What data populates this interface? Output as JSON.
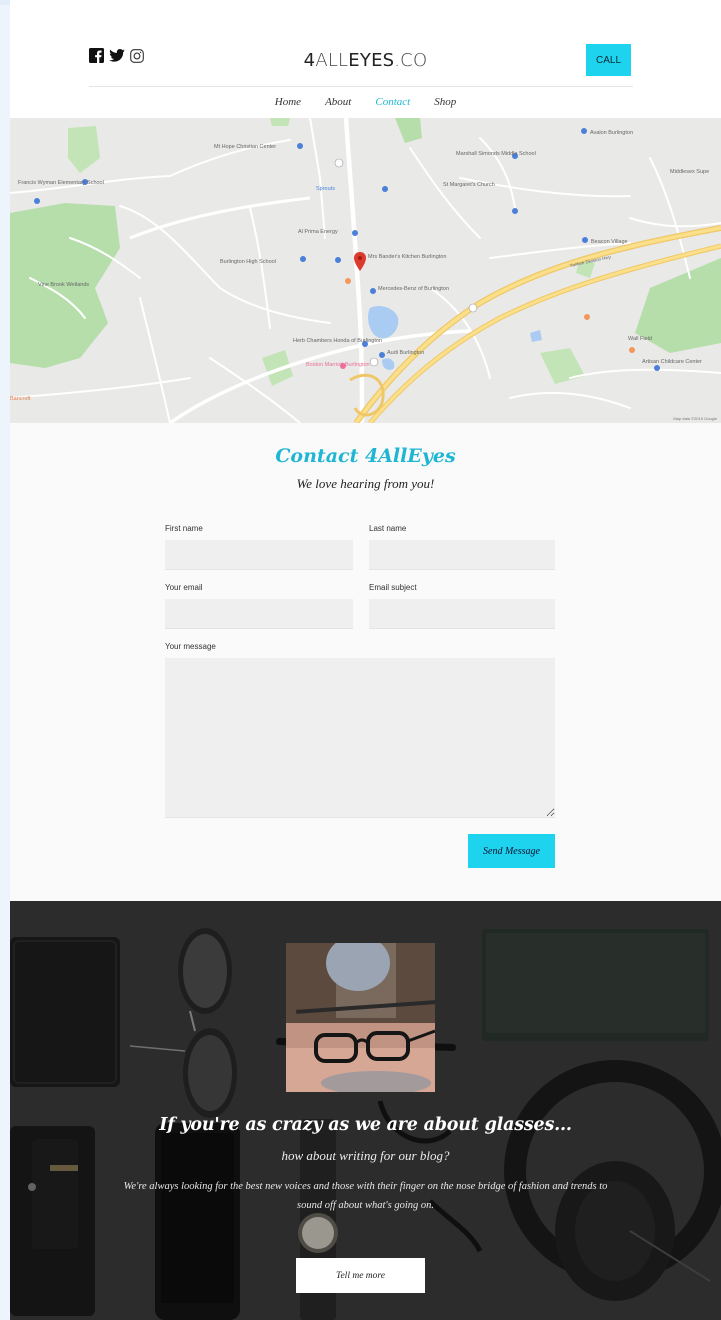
{
  "header": {
    "logo_bold_a": "4",
    "logo_thin_a": "ALL",
    "logo_bold_b": "EYES",
    "logo_thin_b": ".CO",
    "call_label": "CALL",
    "social_icons": [
      "facebook-icon",
      "twitter-icon",
      "instagram-icon"
    ]
  },
  "nav": {
    "items": [
      {
        "label": "Home"
      },
      {
        "label": "About"
      },
      {
        "label": "Contact"
      },
      {
        "label": "Shop"
      }
    ],
    "active": "Contact"
  },
  "map": {
    "labels": [
      "Mt Hope Christian Center",
      "Marshall Simonds Middle School",
      "Avalon Burlington",
      "Middlesex Supe",
      "Francis Wyman Elementary School",
      "Sprouts",
      "St Margaret's Church",
      "Beacon Village",
      "Al Prima Energy",
      "Burlington High School",
      "Mrs Bander's Kitchen Burlington",
      "Mercedes-Benz of Burlington",
      "Vine Brook Wetlands",
      "Herb Chambers Honda of Burlington",
      "Audi Burlington",
      "Boston Marriott Burlington",
      "Wall Field",
      "Artisan Childcare Center",
      "Bancroft",
      "Map data ©2019 Google"
    ],
    "road_label": "Yankee Division Hwy"
  },
  "contact": {
    "title": "Contact 4AllEyes",
    "subtitle": "We love hearing from you!",
    "fields": {
      "first_name": {
        "label": "First name",
        "value": ""
      },
      "last_name": {
        "label": "Last name",
        "value": ""
      },
      "email": {
        "label": "Your email",
        "value": ""
      },
      "subject": {
        "label": "Email subject",
        "value": ""
      },
      "message": {
        "label": "Your message",
        "value": ""
      }
    },
    "submit_label": "Send Message"
  },
  "blog": {
    "heading": "If you're as crazy as we are about glasses...",
    "tagline": "how about writing for our blog?",
    "description": "We're always looking for the best new voices and those with their finger on the nose bridge of fashion and trends to sound off about what's going on.",
    "cta_label": "Tell me more"
  },
  "colors": {
    "accent": "#1ed3ee",
    "title_accent": "#1fb6d3",
    "blog_bg": "#3b3b3b"
  }
}
